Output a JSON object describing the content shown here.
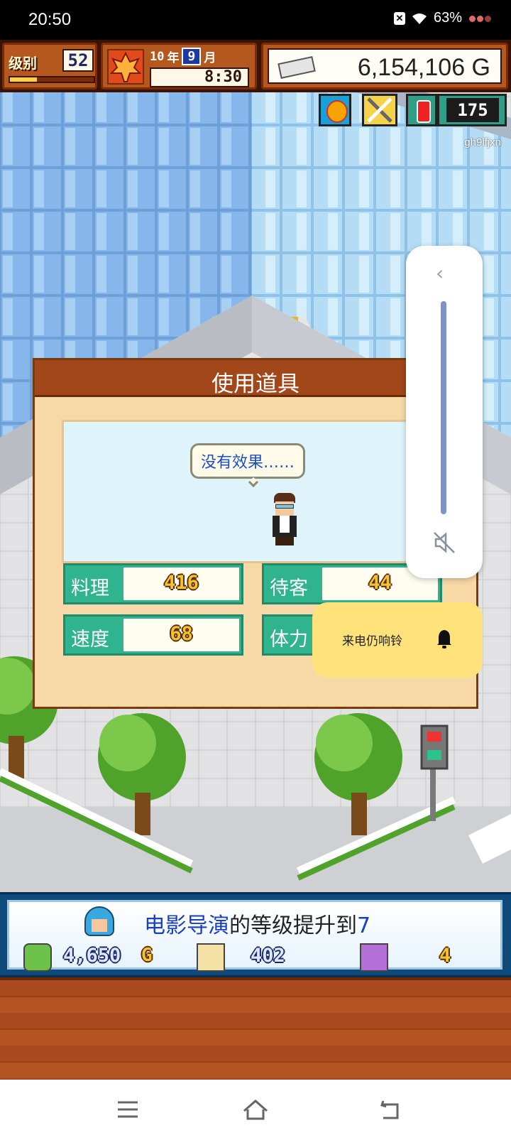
{
  "status_bar": {
    "time": "20:50",
    "battery": "63%",
    "icons": [
      "x-app-icon",
      "wifi-icon",
      "battery-icon",
      "notification-dots-icon"
    ]
  },
  "hud": {
    "level_tag": "级别",
    "level": "52",
    "level_progress": 0.32,
    "year": "10",
    "year_unit": "年",
    "month": "9",
    "month_unit": "月",
    "clock": "8:30",
    "money": "6,154,106 G",
    "count": "175",
    "username": "gh9lfjxn"
  },
  "dialog": {
    "title": "使用道具",
    "bubble": "没有效果……",
    "stats": [
      {
        "label": "料理",
        "value": "416"
      },
      {
        "label": "待客",
        "value": "44"
      },
      {
        "label": "速度",
        "value": "68"
      },
      {
        "label": "体力",
        "value": ""
      }
    ]
  },
  "volume_panel": {
    "toast": "来电仍响铃"
  },
  "info_bar": {
    "message_highlight": "电影导演",
    "message_mid": "的等级提升到",
    "message_level": "7",
    "gold": "4,650",
    "gold_unit": "G",
    "spoon_value": "402",
    "ghost_value": "4"
  },
  "colors": {
    "hud_brown": "#b5581e",
    "stat_green": "#2fb48e",
    "info_blue": "#1a3fc0",
    "toast_yellow": "#ffe27a"
  }
}
